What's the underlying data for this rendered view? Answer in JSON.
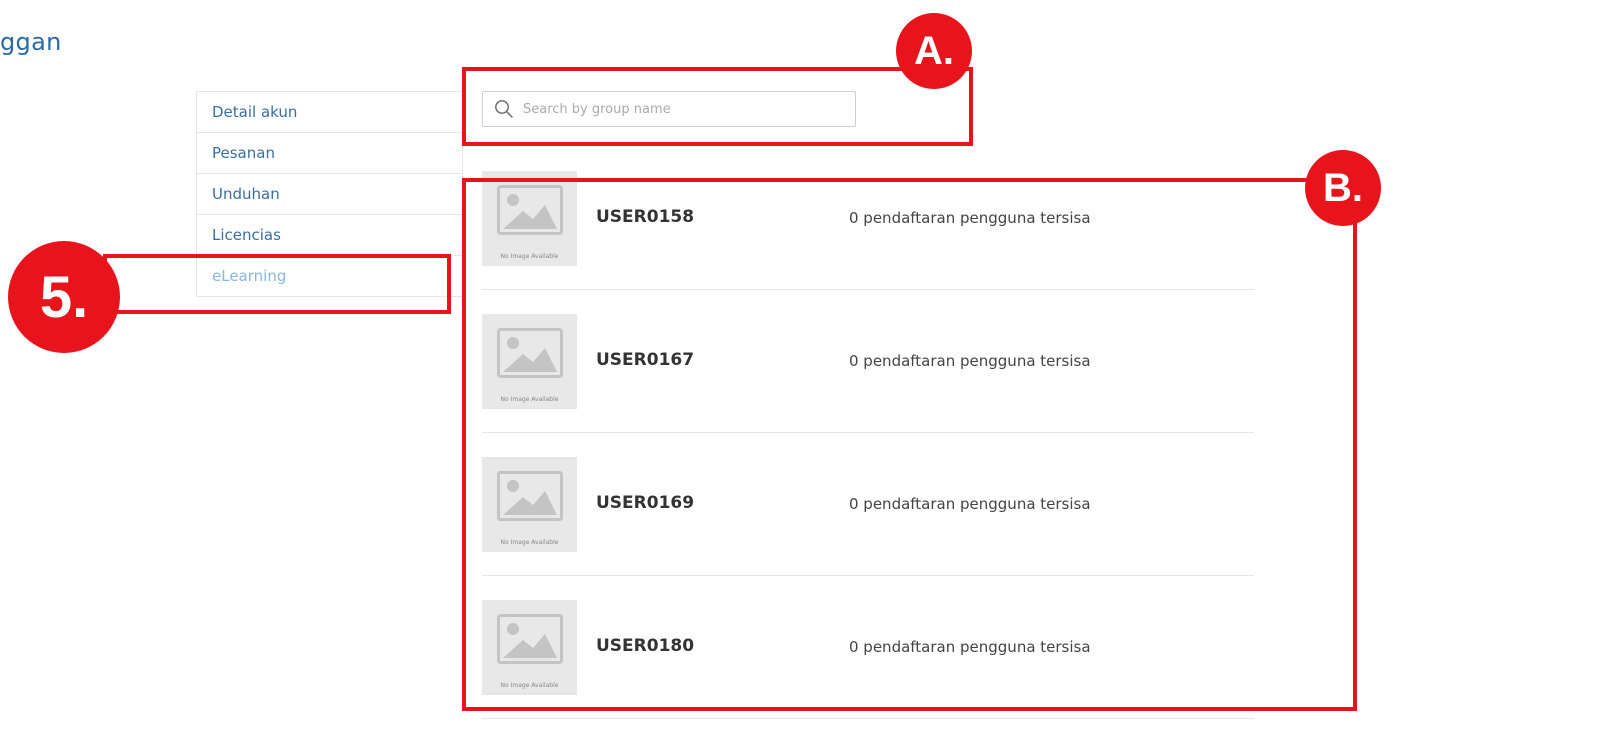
{
  "page": {
    "title": "ggan"
  },
  "sidebar": {
    "items": [
      {
        "label": "Detail akun"
      },
      {
        "label": "Pesanan"
      },
      {
        "label": "Unduhan"
      },
      {
        "label": "Licencias"
      },
      {
        "label": "eLearning"
      }
    ],
    "active_index": 4
  },
  "search": {
    "placeholder": "Search by group name",
    "value": ""
  },
  "groups": [
    {
      "name": "USER0158",
      "status": "0 pendaftaran pengguna tersisa",
      "thumbnail_caption": "No Image Available"
    },
    {
      "name": "USER0167",
      "status": "0 pendaftaran pengguna tersisa",
      "thumbnail_caption": "No Image Available"
    },
    {
      "name": "USER0169",
      "status": "0 pendaftaran pengguna tersisa",
      "thumbnail_caption": "No Image Available"
    },
    {
      "name": "USER0180",
      "status": "0 pendaftaran pengguna tersisa",
      "thumbnail_caption": "No Image Available"
    }
  ],
  "annotations": {
    "a_label": "A.",
    "b_label": "B.",
    "five_label": "5.",
    "color": "#e8141c"
  }
}
